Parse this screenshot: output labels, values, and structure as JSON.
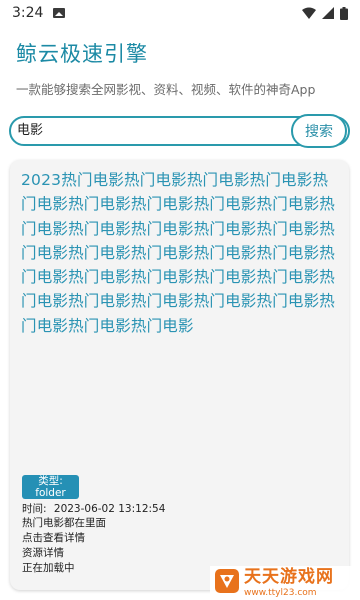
{
  "status_bar": {
    "time": "3:24"
  },
  "app": {
    "title": "鲸云极速引擎",
    "subtitle": "一款能够搜索全网影视、资料、视频、软件的神奇App"
  },
  "search": {
    "value": "电影",
    "button_label": "搜索"
  },
  "result": {
    "title": "2023热门电影热门电影热门电影热门电影热门电影热门电影热门电影热门电影热门电影热门电影热门电影热门电影热门电影热门电影热门电影热门电影热门电影热门电影热门电影热门电影热门电影热门电影热门电影热门电影热门电影热门电影热门电影热门电影热门电影热门电影热门电影热门电影",
    "type_label": "类型:",
    "type_value": "folder",
    "time_label": "时间:",
    "time_value": "2023-06-02 13:12:54",
    "description": "热门电影都在里面",
    "detail_link": "点击查看详情",
    "resource_link": "资源详情",
    "loading_text": "正在加载中"
  },
  "watermark": {
    "name": "天天游戏网",
    "url": "www.ttyl23.com"
  },
  "colors": {
    "accent": "#2a9aac",
    "title_text": "#1c8aa5",
    "badge": "#2590b5",
    "card_bg": "#f4f4f4",
    "watermark": "#e8721c"
  }
}
